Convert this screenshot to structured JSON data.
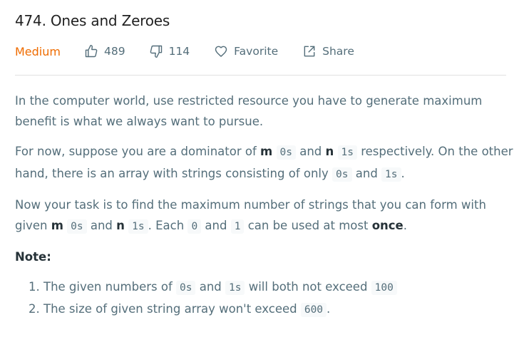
{
  "problem": {
    "title": "474. Ones and Zeroes",
    "difficulty": "Medium",
    "likes": "489",
    "dislikes": "114",
    "favorite_label": "Favorite",
    "share_label": "Share"
  },
  "description": {
    "p1": "In the computer world, use restricted resource you have to generate maximum benefit is what we always want to pursue.",
    "p2": {
      "t1": "For now, suppose you are a dominator of ",
      "b1": "m",
      "c1": "0s",
      "t2": " and ",
      "b2": "n",
      "c2": "1s",
      "t3": " respectively. On the other hand, there is an array with strings consisting of only ",
      "c3": "0s",
      "t4": " and ",
      "c4": "1s",
      "t5": "."
    },
    "p3": {
      "t1": "Now your task is to find the maximum number of strings that you can form with given ",
      "b1": "m",
      "c1": "0s",
      "t2": " and ",
      "b2": "n",
      "c2": "1s",
      "t3": ". Each ",
      "c3": "0",
      "t4": " and ",
      "c4": "1",
      "t5": " can be used at most ",
      "b3": "once",
      "t6": "."
    },
    "note_label": "Note:",
    "notes": [
      {
        "t1": "The given numbers of ",
        "c1": "0s",
        "t2": " and ",
        "c2": "1s",
        "t3": " will both not exceed ",
        "c3": "100"
      },
      {
        "t1": "The size of given string array won't exceed ",
        "c1": "600",
        "t2": "."
      }
    ]
  },
  "colors": {
    "difficulty_medium": "#ef6c00",
    "text": "#546e7a",
    "heading": "#212121",
    "code_bg": "#f7f9fa"
  },
  "icons": [
    "thumbs-up-icon",
    "thumbs-down-icon",
    "heart-icon",
    "share-icon"
  ]
}
